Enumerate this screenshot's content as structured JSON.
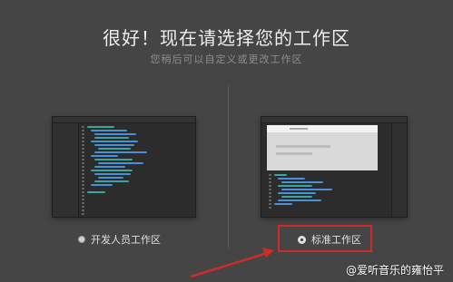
{
  "header": {
    "title": "很好！现在请选择您的工作区",
    "subtitle": "您稍后可以自定义或更改工作区"
  },
  "options": [
    {
      "label": "开发人员工作区",
      "selected": false
    },
    {
      "label": "标准工作区",
      "selected": true
    }
  ],
  "annotation": {
    "highlight_color": "#d02a2a"
  },
  "watermark": {
    "text": "@爱听音乐的雍怡平"
  },
  "colors": {
    "background": "#454545",
    "code_blue": "#4a90d9",
    "code_teal": "#3aa6a0"
  }
}
